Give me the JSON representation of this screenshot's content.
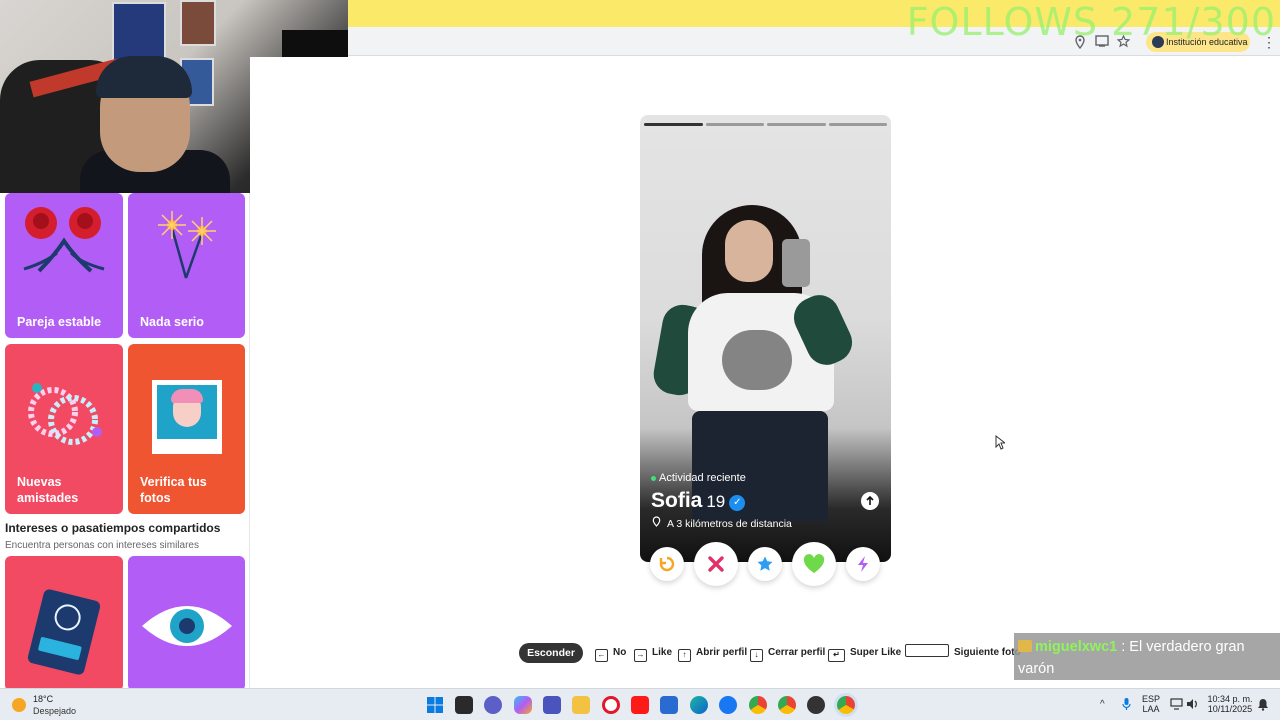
{
  "stream_overlay": {
    "follows_goal": "FOLLOWS 271/300",
    "chat": {
      "user": "miguelxwc1",
      "separator": ":",
      "message": "El verdadero gran varón"
    }
  },
  "browser": {
    "profile_chip": "Institución educativa",
    "icons": [
      "location-icon",
      "cast-icon",
      "star-icon"
    ],
    "menu_icon": "⋮"
  },
  "sidebar": {
    "tiles_top": [
      {
        "label": "Pareja estable",
        "color": "#b25df5"
      },
      {
        "label": "Nada serio",
        "color": "#b25df5"
      }
    ],
    "tiles_mid": [
      {
        "label": "Nuevas amistades",
        "color": "#f24a62"
      },
      {
        "label": "Verifica tus fotos",
        "color": "#f05532"
      }
    ],
    "section_title": "Intereses o pasatiempos compartidos",
    "section_subtitle": "Encuentra personas con intereses similares",
    "tiles_bottom": [
      {
        "color": "#f24a62"
      },
      {
        "color": "#b25df5"
      }
    ]
  },
  "profile_card": {
    "activity": "Actividad reciente",
    "name": "Sofia",
    "age": "19",
    "distance": "A 3 kilómetros de distancia",
    "photo_count": 4,
    "active_photo": 1
  },
  "actions": [
    {
      "name": "rewind",
      "color": "#f6a623"
    },
    {
      "name": "nope",
      "color": "#e3306a"
    },
    {
      "name": "super-like",
      "color": "#2d9ef0"
    },
    {
      "name": "like",
      "color": "#6fd94a"
    },
    {
      "name": "boost",
      "color": "#b25df5"
    }
  ],
  "shortcuts": {
    "hide": "Esconder",
    "items": [
      {
        "key": "←",
        "label": "No"
      },
      {
        "key": "→",
        "label": "Like"
      },
      {
        "key": "↑",
        "label": "Abrir perfil"
      },
      {
        "key": "↓",
        "label": "Cerrar perfil"
      },
      {
        "key": "↵",
        "label": "Super Like"
      },
      {
        "key": "",
        "label": "Siguiente foto"
      }
    ]
  },
  "taskbar": {
    "weather_temp": "18°C",
    "weather_cond": "Despejado",
    "language_line1": "ESP",
    "language_line2": "LAA",
    "time": "10:34 p. m.",
    "date": "10/11/2025"
  }
}
